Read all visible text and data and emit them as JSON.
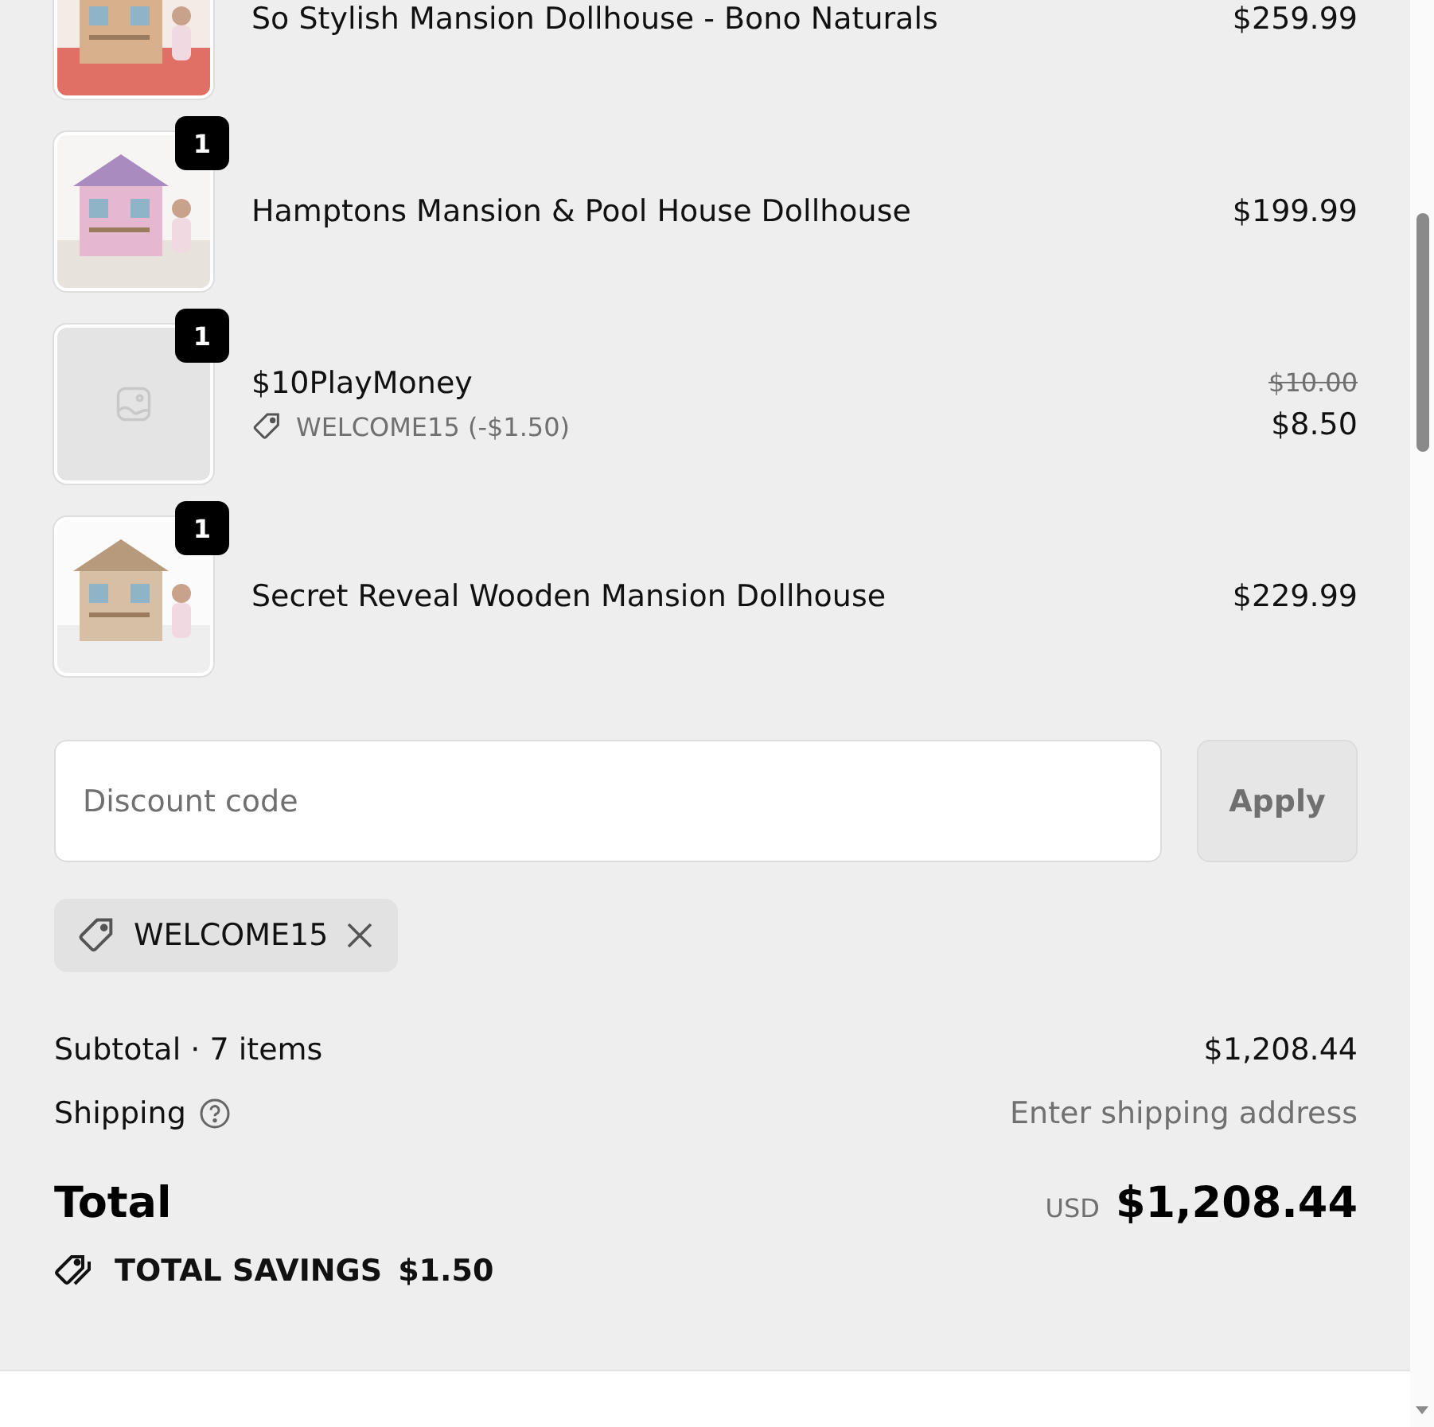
{
  "items": [
    {
      "kind": "picture",
      "title": "So Stylish Mansion Dollhouse - Bono Naturals",
      "price": "$259.99"
    },
    {
      "kind": "picture",
      "quantity": "1",
      "title": "Hamptons Mansion & Pool House Dollhouse",
      "price": "$199.99"
    },
    {
      "kind": "placeholder",
      "quantity": "1",
      "title": "$10PlayMoney",
      "discount": "WELCOME15 (-$1.50)",
      "original_price": "$10.00",
      "price": "$8.50"
    },
    {
      "kind": "picture",
      "quantity": "1",
      "title": "Secret Reveal Wooden Mansion Dollhouse",
      "price": "$229.99"
    }
  ],
  "discount_field": {
    "placeholder": "Discount code"
  },
  "apply_button": {
    "label": "Apply",
    "disabled": true
  },
  "applied_code": {
    "code": "WELCOME15"
  },
  "subtotal": {
    "label": "Subtotal · 7 items",
    "value": "$1,208.44"
  },
  "shipping": {
    "label": "Shipping",
    "value": "Enter shipping address"
  },
  "total": {
    "label": "Total",
    "currency": "USD",
    "value": "$1,208.44"
  },
  "savings": {
    "label": "TOTAL SAVINGS",
    "value": "$1.50"
  }
}
